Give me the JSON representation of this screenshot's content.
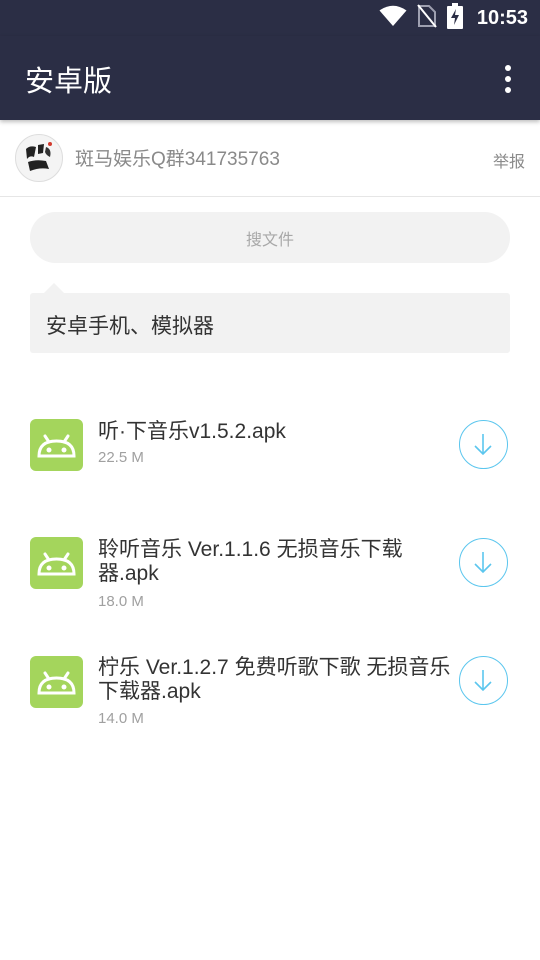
{
  "status_bar": {
    "time": "10:53",
    "icons": [
      "wifi-icon",
      "no-sim-icon",
      "battery-charging-icon"
    ]
  },
  "app_bar": {
    "title": "安卓版",
    "menu_icon": "more-vert-icon"
  },
  "owner": {
    "avatar_icon": "zebra-logo",
    "avatar_text": "斑马",
    "name": "斑马娱乐Q群341735763",
    "report_label": "举报"
  },
  "search": {
    "placeholder": "搜文件"
  },
  "folder": {
    "label": "安卓手机、模拟器"
  },
  "files": [
    {
      "name": "听·下音乐v1.5.2.apk",
      "size": "22.5 M",
      "icon": "android-icon"
    },
    {
      "name": "聆听音乐 Ver.1.1.6 无损音乐下载器.apk",
      "size": "18.0 M",
      "icon": "android-icon"
    },
    {
      "name": "柠乐 Ver.1.2.7  免费听歌下歌 无损音乐下载器.apk",
      "size": "14.0 M",
      "icon": "android-icon"
    }
  ],
  "colors": {
    "app_bar": "#2b2e45",
    "android_green": "#a4d55c",
    "download_accent": "#5bc6ee"
  }
}
